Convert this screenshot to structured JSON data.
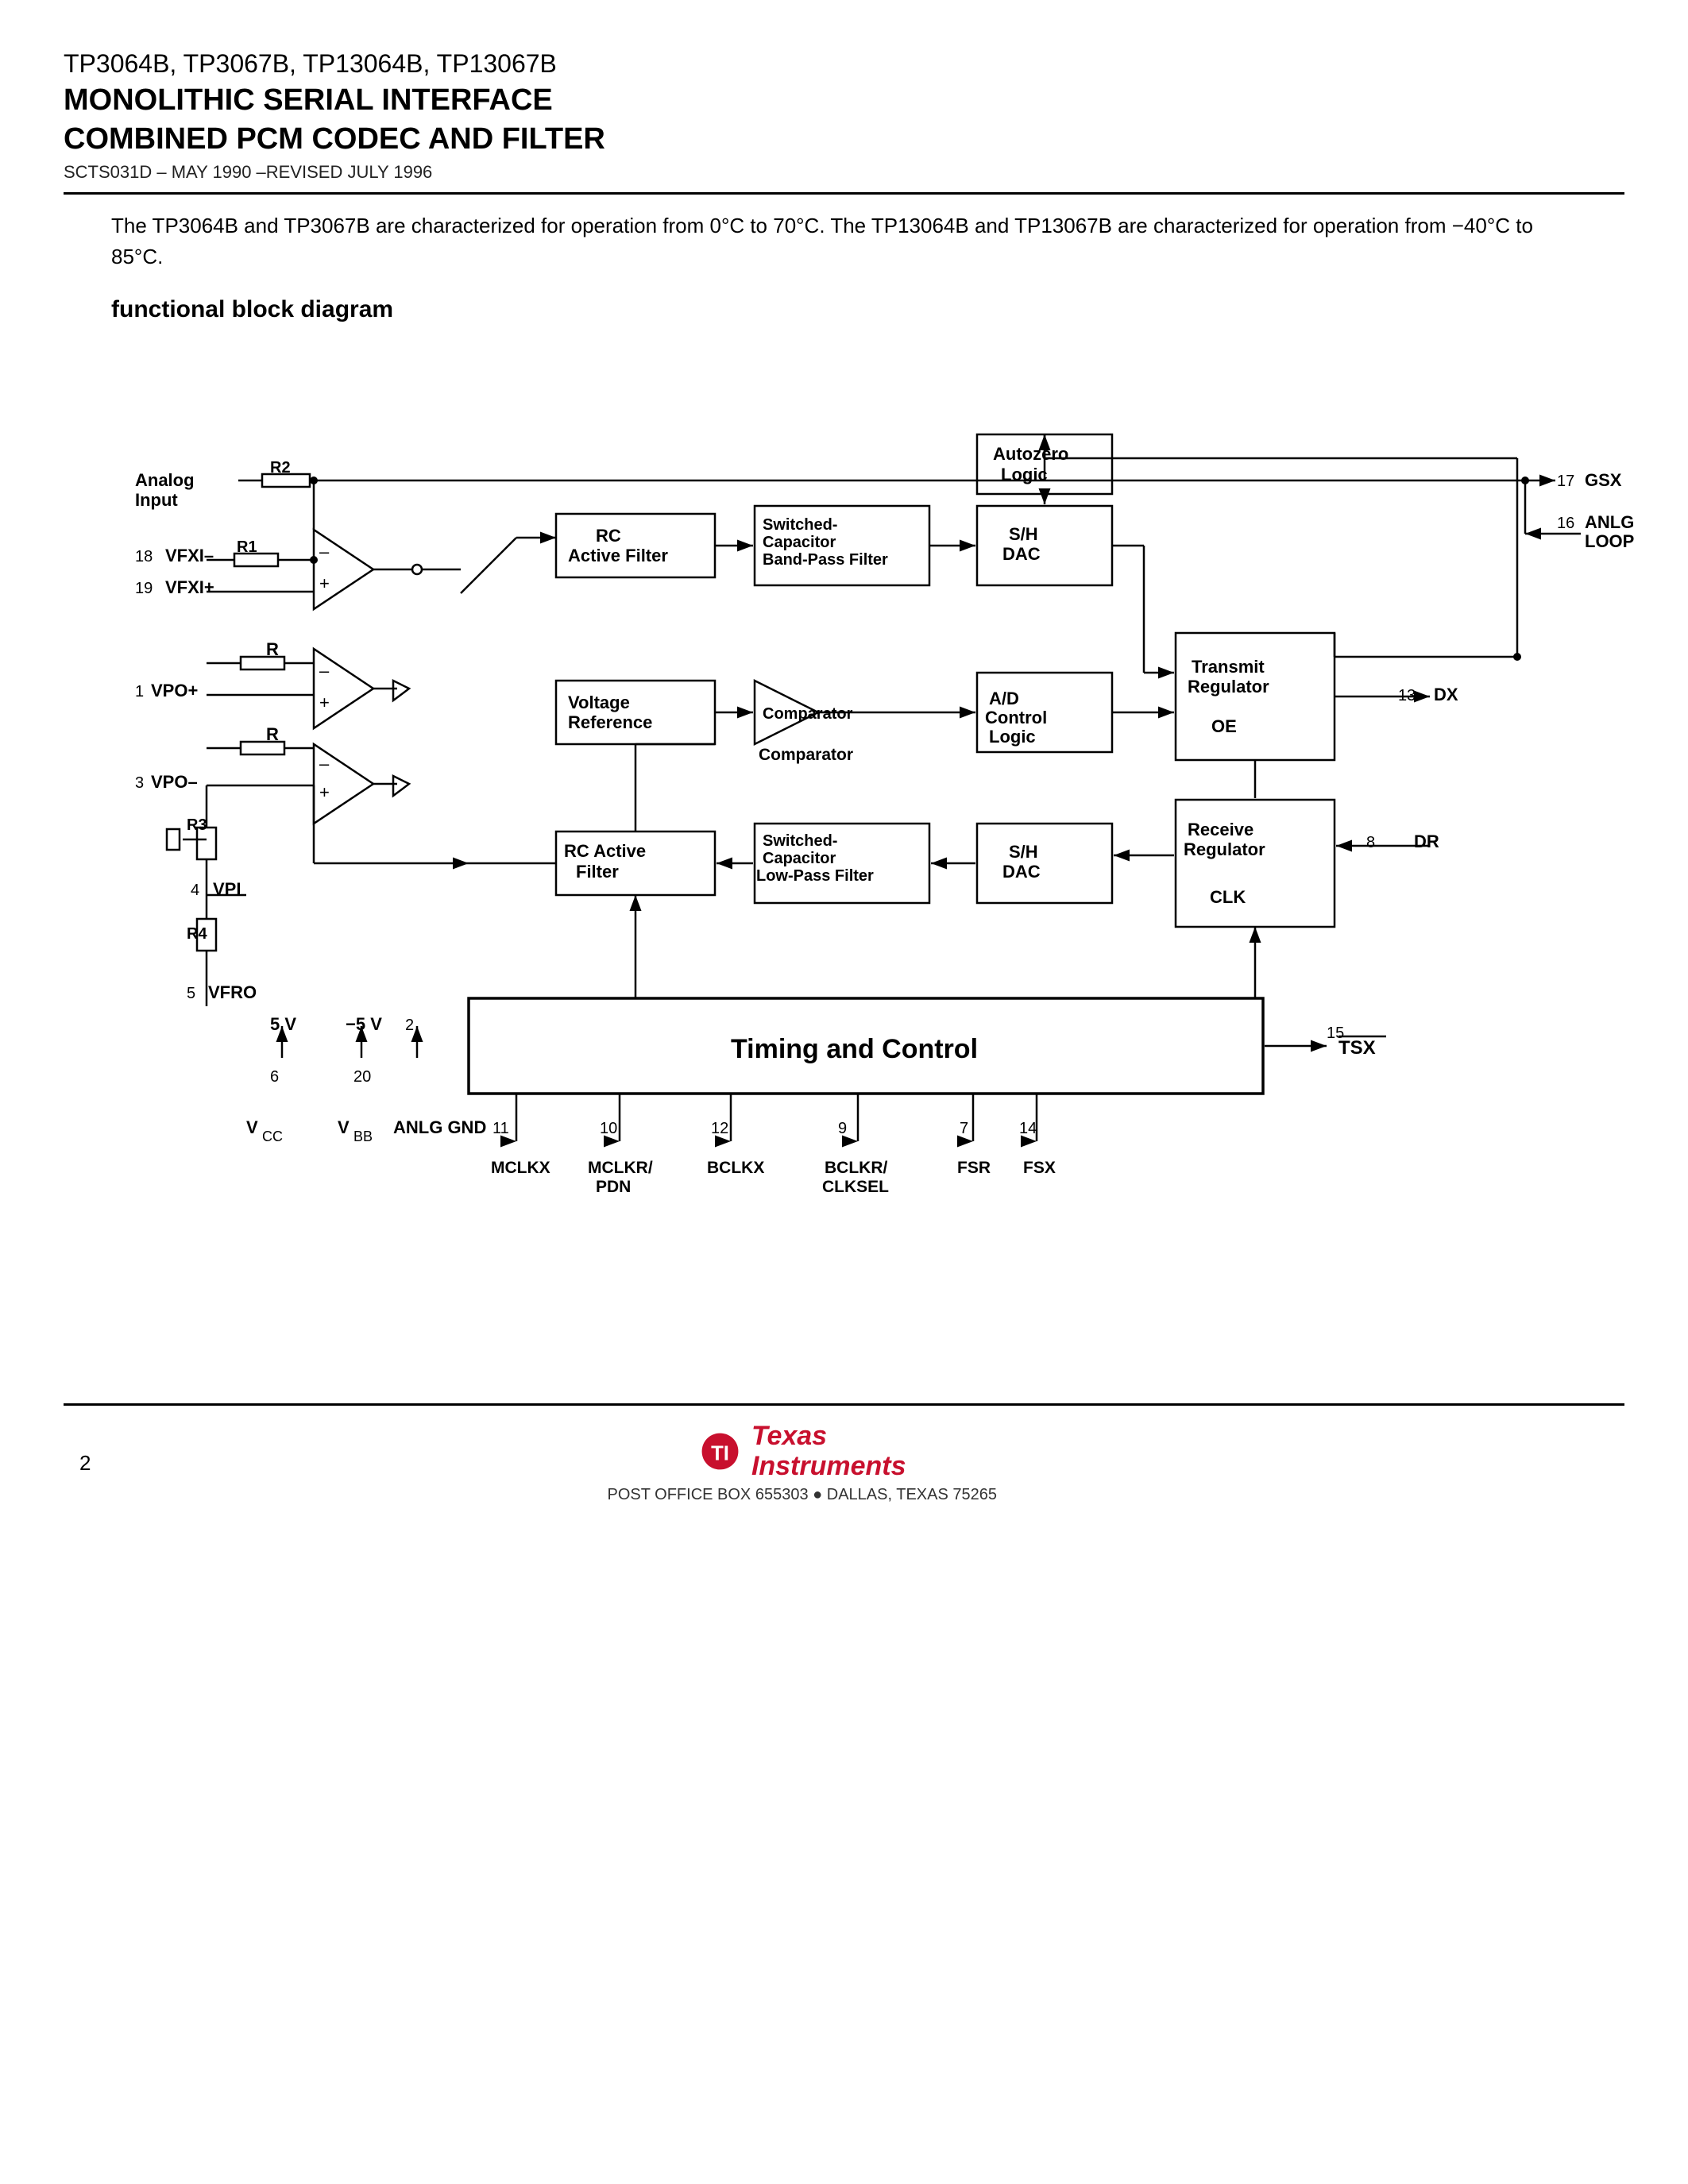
{
  "header": {
    "part_numbers": "TP3064B, TP3067B, TP13064B, TP13067B",
    "line1": "MONOLITHIC SERIAL INTERFACE",
    "line2": "COMBINED PCM CODEC AND FILTER",
    "doc_info": "SCTS031D – MAY 1990 –REVISED JULY 1996"
  },
  "intro": {
    "text": "The TP3064B and TP3067B are characterized for operation from 0°C to 70°C. The TP13064B and TP13067B are characterized for operation from −40°C to 85°C."
  },
  "section": {
    "title": "functional block diagram"
  },
  "footer": {
    "page_number": "2",
    "company_name": "Texas\nInstruments",
    "address": "POST OFFICE BOX 655303 ● DALLAS, TEXAS 75265"
  }
}
